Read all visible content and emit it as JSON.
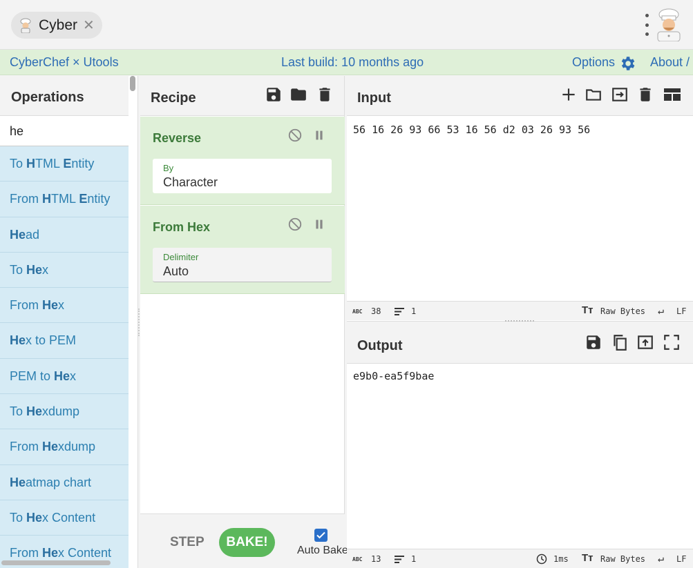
{
  "window": {
    "tab_title": "Cyber",
    "tab_close": "✕"
  },
  "banner": {
    "app_name": "CyberChef × Utools",
    "build": "Last build: 10 months ago",
    "options": "Options",
    "about": "About /"
  },
  "operations": {
    "title": "Operations",
    "search_value": "he",
    "items": [
      {
        "pre": "To ",
        "b1": "H",
        "mid": "TML ",
        "b2": "E",
        "post": "ntity"
      },
      {
        "pre": "From ",
        "b1": "H",
        "mid": "TML ",
        "b2": "E",
        "post": "ntity"
      },
      {
        "pre": "",
        "b1": "He",
        "mid": "ad",
        "b2": "",
        "post": ""
      },
      {
        "pre": "To ",
        "b1": "He",
        "mid": "x",
        "b2": "",
        "post": ""
      },
      {
        "pre": "From ",
        "b1": "He",
        "mid": "x",
        "b2": "",
        "post": ""
      },
      {
        "pre": "",
        "b1": "He",
        "mid": "x to PEM",
        "b2": "",
        "post": ""
      },
      {
        "pre": "PEM to ",
        "b1": "He",
        "mid": "x",
        "b2": "",
        "post": ""
      },
      {
        "pre": "To ",
        "b1": "He",
        "mid": "xdump",
        "b2": "",
        "post": ""
      },
      {
        "pre": "From ",
        "b1": "He",
        "mid": "xdump",
        "b2": "",
        "post": ""
      },
      {
        "pre": "",
        "b1": "He",
        "mid": "atmap chart",
        "b2": "",
        "post": ""
      },
      {
        "pre": "To ",
        "b1": "He",
        "mid": "x Content",
        "b2": "",
        "post": ""
      },
      {
        "pre": "From ",
        "b1": "He",
        "mid": "x Content",
        "b2": "",
        "post": ""
      }
    ]
  },
  "recipe": {
    "title": "Recipe",
    "ops": [
      {
        "name": "Reverse",
        "arg_label": "By",
        "arg_value": "Character"
      },
      {
        "name": "From Hex",
        "arg_label": "Delimiter",
        "arg_value": "Auto"
      }
    ],
    "step": "STEP",
    "bake": "BAKE!",
    "auto_bake": "Auto Bake"
  },
  "input": {
    "title": "Input",
    "value": "56 16 26 93 66 53 16 56 d2 03 26 93 56",
    "status": {
      "abc": "ABC",
      "chars": "38",
      "lines": "1",
      "encoding": "Raw Bytes",
      "eol": "LF"
    }
  },
  "output": {
    "title": "Output",
    "value": "e9b0-ea5f9bae",
    "status": {
      "abc": "ABC",
      "chars": "13",
      "lines": "1",
      "time": "1ms",
      "encoding": "Raw Bytes",
      "eol": "LF"
    }
  },
  "colors": {
    "banner_bg": "#dff0d8",
    "link": "#2d6cb5",
    "recipe_green": "#3c7a3a",
    "bake_green": "#5cb85c",
    "ops_blue": "#d6ebf5"
  }
}
